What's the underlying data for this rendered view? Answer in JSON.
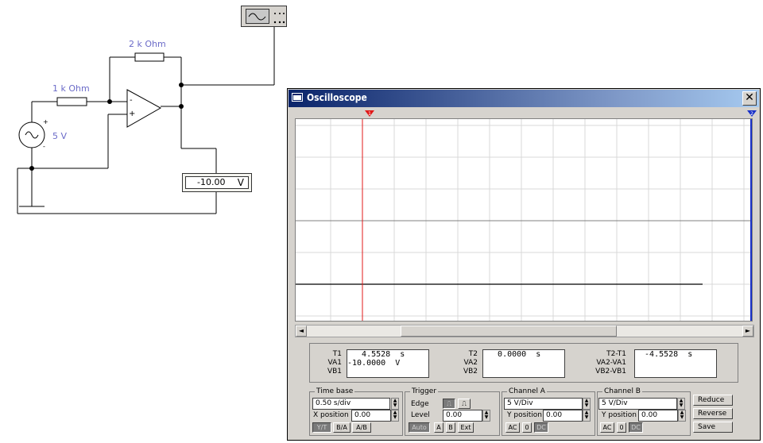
{
  "circuit": {
    "resistor_feedback_label": "2 k Ohm",
    "resistor_input_label": "1 k Ohm",
    "source_label": "5 V",
    "source_plus": "+",
    "source_minus": "-",
    "opamp_minus": "-",
    "opamp_plus": "+",
    "voltmeter_value": "-10.00",
    "voltmeter_unit": "V"
  },
  "window": {
    "title": "Oscilloscope",
    "close_glyph": "✕",
    "cursor1_label": "1",
    "cursor2_label": "2",
    "scroll_left": "◄",
    "scroll_right": "►"
  },
  "readout": {
    "t1_label": "T1",
    "va1_label": "VA1",
    "vb1_label": "VB1",
    "t1_value": "   4.5528  s",
    "va1_value": "-10.0000  V",
    "vb1_value": "",
    "t2_label": "T2",
    "va2_label": "VA2",
    "vb2_label": "VB2",
    "t2_value": "   0.0000  s",
    "va2_value": "",
    "vb2_value": "",
    "dt_label": "T2-T1",
    "dva_label": "VA2-VA1",
    "dvb_label": "VB2-VB1",
    "dt_value": "  -4.5528  s",
    "dva_value": "",
    "dvb_value": ""
  },
  "controls": {
    "timebase": {
      "title": "Time base",
      "value": "0.50 s/div",
      "xpos_label": "X position",
      "xpos_value": "0.00",
      "btn_yt": "Y/T",
      "btn_ba": "B/A",
      "btn_ab": "A/B"
    },
    "trigger": {
      "title": "Trigger",
      "edge_label": "Edge",
      "level_label": "Level",
      "level_value": "0.00",
      "btn_auto": "Auto",
      "btn_a": "A",
      "btn_b": "B",
      "btn_ext": "Ext"
    },
    "channel_a": {
      "title": "Channel A",
      "value": "5 V/Div",
      "ypos_label": "Y position",
      "ypos_value": "0.00",
      "btn_ac": "AC",
      "btn_0": "0",
      "btn_dc": "DC"
    },
    "channel_b": {
      "title": "Channel B",
      "value": "5 V/Div",
      "ypos_label": "Y position",
      "ypos_value": "0.00",
      "btn_ac": "AC",
      "btn_0": "0",
      "btn_dc": "DC"
    },
    "btn_reduce": "Reduce",
    "btn_reverse": "Reverse",
    "btn_save": "Save"
  },
  "colors": {
    "trace": "#000000",
    "cursor1": "#e01818",
    "cursor2": "#1830c8",
    "wire": "#000000",
    "label": "#6b6bc8"
  }
}
